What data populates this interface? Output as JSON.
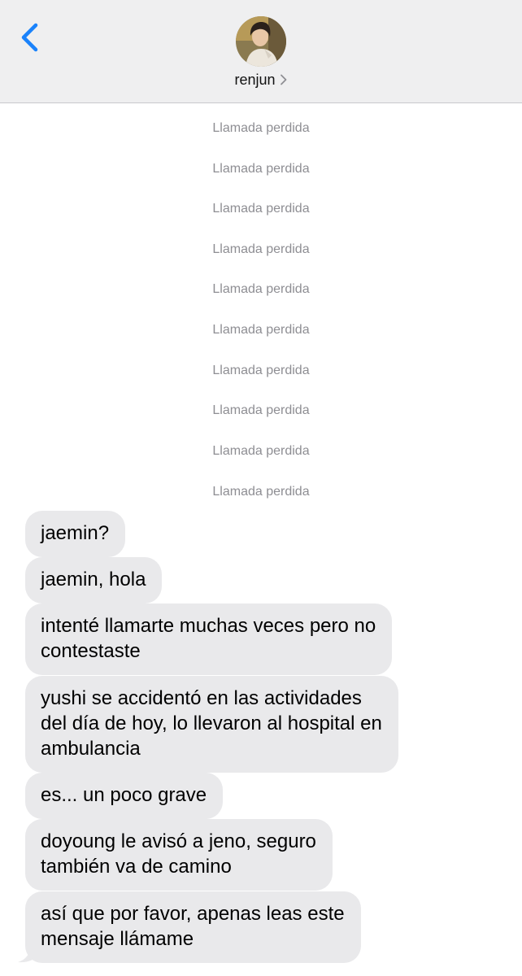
{
  "header": {
    "contact_name": "renjun",
    "back_icon": "chevron-left-icon",
    "chevron_icon": "chevron-right-icon",
    "accent_color": "#1a82fb"
  },
  "missed_calls": [
    "Llamada perdida",
    "Llamada perdida",
    "Llamada perdida",
    "Llamada perdida",
    "Llamada perdida",
    "Llamada perdida",
    "Llamada perdida",
    "Llamada perdida",
    "Llamada perdida",
    "Llamada perdida"
  ],
  "messages": [
    "jaemin?",
    "jaemin, hola",
    "intenté llamarte muchas veces pero no\ncontestaste",
    "yushi se accidentó en las actividades\ndel día de hoy, lo llevaron al hospital en\nambulancia",
    "es... un poco grave",
    "doyoung le avisó a jeno, seguro\ntambién va de camino",
    "así que por favor, apenas leas este\nmensaje llámame"
  ],
  "colors": {
    "incoming_bubble": "#e9e9eb",
    "system_text": "#8e8e93",
    "header_bg": "#efeff0"
  }
}
